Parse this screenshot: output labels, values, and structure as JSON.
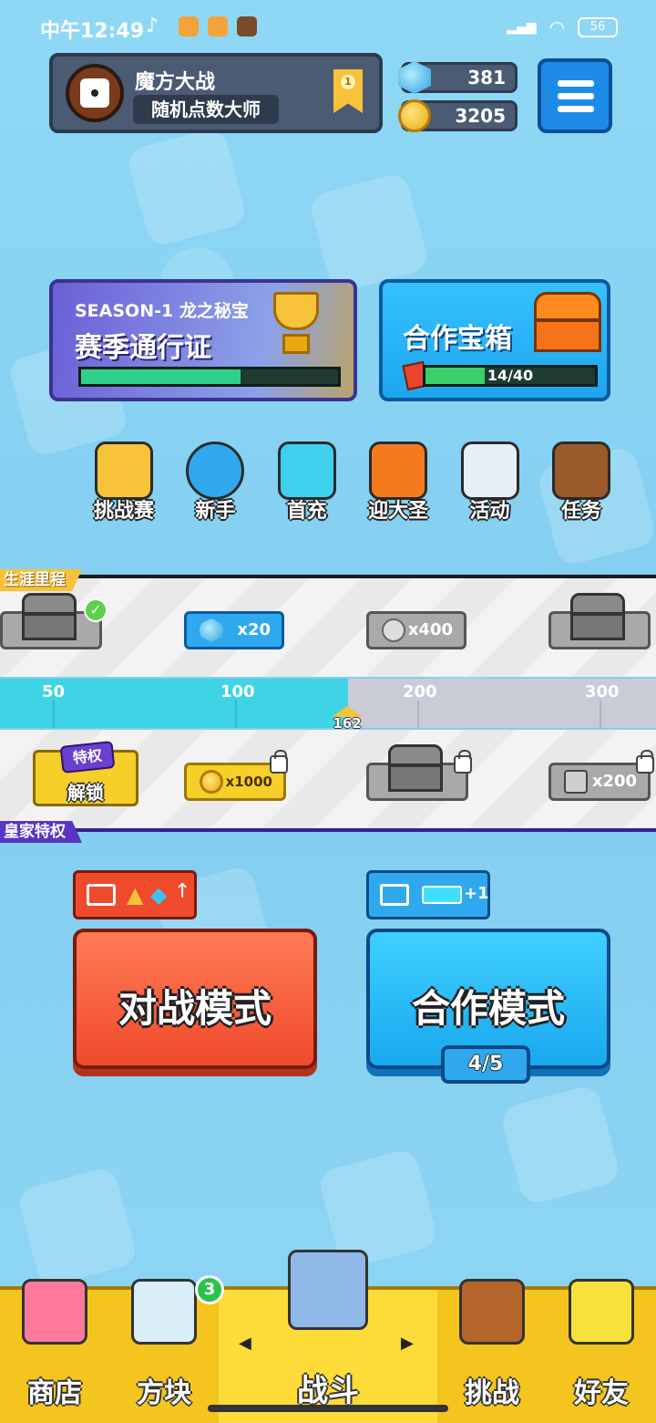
{
  "status_bar": {
    "time": "中午12:49",
    "battery": "56"
  },
  "profile": {
    "name": "魔方大战",
    "title": "随机点数大师",
    "rank": "1"
  },
  "currency": {
    "gems": "381",
    "coins": "3205"
  },
  "season_pass": {
    "tag": "SEASON-1 龙之秘宝",
    "title": "赛季通行证",
    "progress": 0.62
  },
  "coop_chest": {
    "title": "合作宝箱",
    "progress_text": "14/40",
    "progress": 0.35
  },
  "shortcuts": [
    {
      "label": "挑战赛",
      "icon": "challenge-blocks-icon"
    },
    {
      "label": "新手",
      "icon": "stopwatch-icon"
    },
    {
      "label": "首充",
      "icon": "gift-box-icon"
    },
    {
      "label": "迎大圣",
      "icon": "monkey-king-icon"
    },
    {
      "label": "活动",
      "icon": "event-scroll-icon"
    },
    {
      "label": "任务",
      "icon": "quest-book-icon"
    }
  ],
  "career": {
    "tag": "生涯里程",
    "rewards": [
      "x20",
      "x400"
    ]
  },
  "milestone": {
    "ticks": [
      "50",
      "100",
      "200",
      "300"
    ],
    "current": "162",
    "fill": 0.53
  },
  "royal": {
    "tag": "皇家特权",
    "unlock_badge": "特权",
    "unlock_label": "解锁",
    "rewards": [
      "x1000",
      "x200"
    ]
  },
  "modes": {
    "battle": "对战模式",
    "coop": "合作模式",
    "coop_count": "4/5",
    "coop_bonus": "+1"
  },
  "nav": {
    "items": [
      "商店",
      "方块",
      "战斗",
      "挑战",
      "好友"
    ],
    "cube_badge": "3"
  },
  "colors": {
    "accent_blue": "#1c8be8",
    "battle_red": "#f04a2c",
    "nav_yellow": "#f4c51e"
  }
}
